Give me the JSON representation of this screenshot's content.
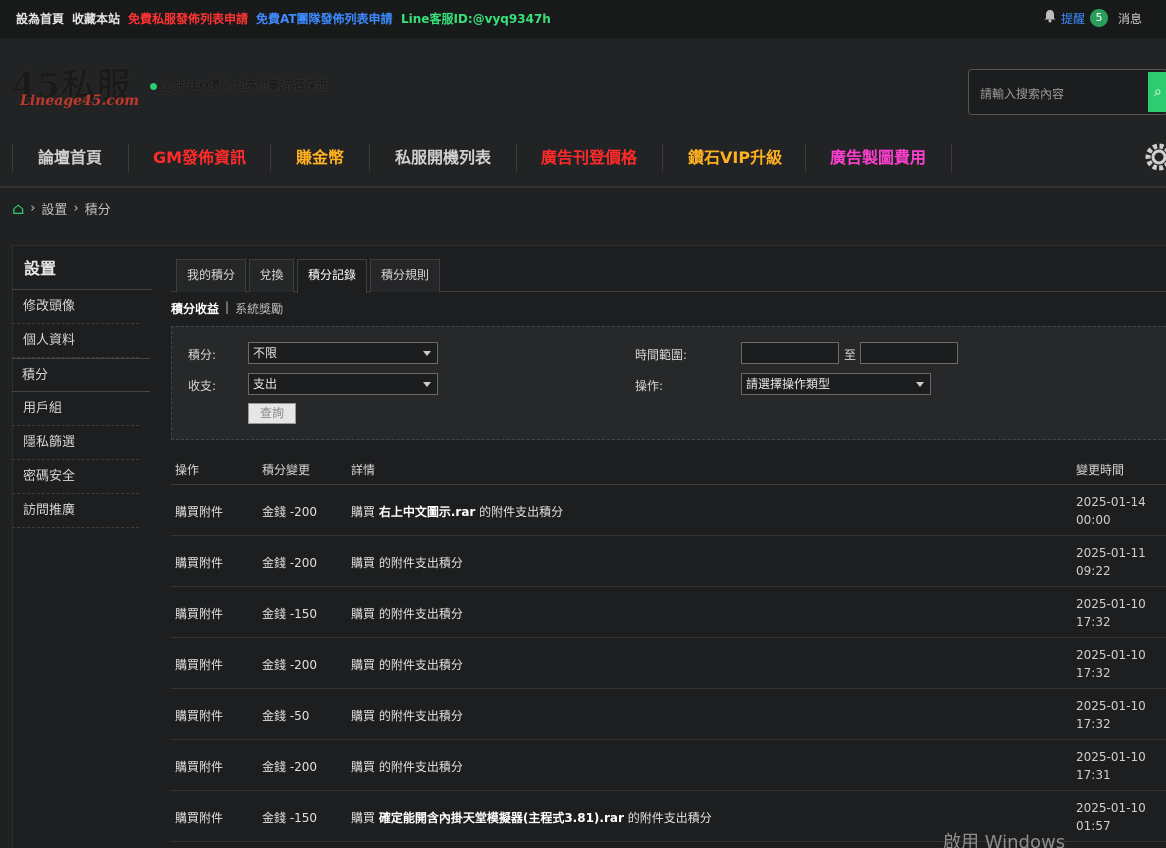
{
  "topbar": {
    "set_home": "設為首頁",
    "bookmark": "收藏本站",
    "link_free_private": "免費私服發佈列表申請",
    "link_free_at": "免費AT團隊發佈列表申請",
    "line_id": "Line客服ID:@vyq9347h",
    "remind_label": "提醒",
    "remind_count": "5",
    "messages_label": "消息"
  },
  "header": {
    "logo_text": "45私服",
    "logo_sub": "Lineage45.com",
    "slogan": "全站SEO優化,超高流量,品質保證",
    "search_placeholder": "請輸入搜索內容"
  },
  "nav": {
    "items": [
      {
        "label": "論壇首頁",
        "color": "#d0d0d0"
      },
      {
        "label": "GM發佈資訊",
        "color": "#ff2a2a"
      },
      {
        "label": "賺金幣",
        "color": "#ffb020"
      },
      {
        "label": "私服開機列表",
        "color": "#d0d0d0"
      },
      {
        "label": "廣告刊登價格",
        "color": "#ff2a2a"
      },
      {
        "label": "鑽石VIP升級",
        "color": "#ffb020"
      },
      {
        "label": "廣告製圖費用",
        "color": "#ff3fd0"
      }
    ]
  },
  "breadcrumb": {
    "home_icon": "home-glyph",
    "items": [
      "設置",
      "積分"
    ]
  },
  "sidebar": {
    "title": "設置",
    "items": [
      "修改頭像",
      "個人資料",
      "積分",
      "用戶組",
      "隱私篩選",
      "密碼安全",
      "訪問推廣"
    ],
    "active_index": 2
  },
  "tabs": [
    "我的積分",
    "兌換",
    "積分記錄",
    "積分規則"
  ],
  "active_tab": 2,
  "subtabs": {
    "active": "積分收益",
    "separator": "|",
    "other": "系統獎勵"
  },
  "filter": {
    "credit_label": "積分:",
    "credit_value": "不限",
    "inout_label": "收支:",
    "inout_value": "支出",
    "time_label": "時間範圍:",
    "time_to": "至",
    "op_label": "操作:",
    "op_value": "請選擇操作類型",
    "query_button": "查詢"
  },
  "table": {
    "headers": [
      "操作",
      "積分變更",
      "詳情",
      "變更時間"
    ],
    "rows": [
      {
        "op": "購買附件",
        "change": "金錢 -200",
        "detail_prefix": "購買",
        "detail_file": "右上中文圖示.rar",
        "detail_suffix": "的附件支出積分",
        "date": "2025-01-14",
        "time": "00:00"
      },
      {
        "op": "購買附件",
        "change": "金錢 -200",
        "detail_prefix": "購買",
        "detail_file": "",
        "detail_suffix": "的附件支出積分",
        "date": "2025-01-11",
        "time": "09:22"
      },
      {
        "op": "購買附件",
        "change": "金錢 -150",
        "detail_prefix": "購買",
        "detail_file": "",
        "detail_suffix": "的附件支出積分",
        "date": "2025-01-10",
        "time": "17:32"
      },
      {
        "op": "購買附件",
        "change": "金錢 -200",
        "detail_prefix": "購買",
        "detail_file": "",
        "detail_suffix": "的附件支出積分",
        "date": "2025-01-10",
        "time": "17:32"
      },
      {
        "op": "購買附件",
        "change": "金錢 -50",
        "detail_prefix": "購買",
        "detail_file": "",
        "detail_suffix": "的附件支出積分",
        "date": "2025-01-10",
        "time": "17:32"
      },
      {
        "op": "購買附件",
        "change": "金錢 -200",
        "detail_prefix": "購買",
        "detail_file": "",
        "detail_suffix": "的附件支出積分",
        "date": "2025-01-10",
        "time": "17:31"
      },
      {
        "op": "購買附件",
        "change": "金錢 -150",
        "detail_prefix": "購買",
        "detail_file": "確定能開含內掛天堂模擬器(主程式3.81).rar",
        "detail_suffix": "的附件支出積分",
        "date": "2025-01-10",
        "time": "01:57"
      }
    ]
  },
  "watermark": "啟用 Windows"
}
